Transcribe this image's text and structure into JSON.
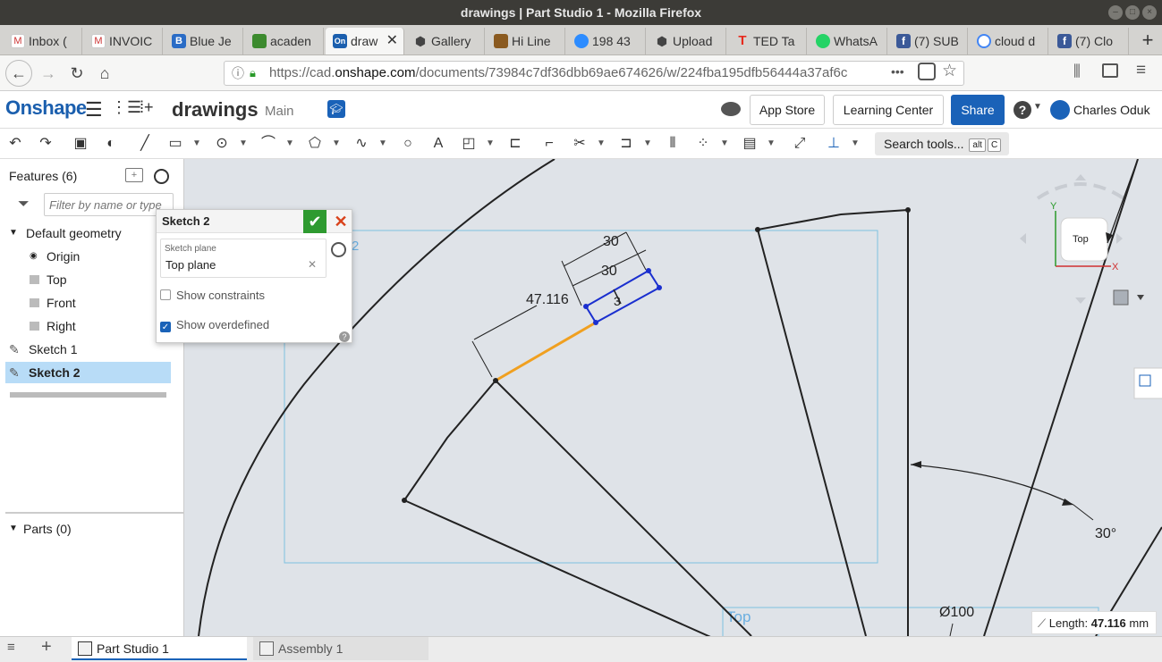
{
  "window": {
    "title": "drawings | Part Studio 1 - Mozilla Firefox"
  },
  "browser_tabs": [
    {
      "label": "Inbox (",
      "icon": "gmail-icon"
    },
    {
      "label": "INVOIC",
      "icon": "gmail-icon"
    },
    {
      "label": "Blue Je",
      "icon": "b-icon"
    },
    {
      "label": "acaden",
      "icon": "puzzle-icon"
    },
    {
      "label": "draw",
      "icon": "onshape-icon",
      "active": true
    },
    {
      "label": "Gallery",
      "icon": "box-icon"
    },
    {
      "label": "Hi Line",
      "icon": "store-icon"
    },
    {
      "label": "198 43",
      "icon": "zoom-icon"
    },
    {
      "label": "Upload",
      "icon": "box-icon"
    },
    {
      "label": "TED Ta",
      "icon": "ted-icon"
    },
    {
      "label": "WhatsA",
      "icon": "whatsapp-icon"
    },
    {
      "label": "(7) SUB",
      "icon": "facebook-icon"
    },
    {
      "label": "cloud d",
      "icon": "google-icon"
    },
    {
      "label": "(7) Clo",
      "icon": "facebook-icon"
    }
  ],
  "navbar": {
    "url_prefix": "https://cad.",
    "url_domain": "onshape.com",
    "url_rest": "/documents/73984c7df36dbb69ae674626/w/224fba195dfb56444a37af6c",
    "more": "•••"
  },
  "header": {
    "logo": "Onshape",
    "doc_name": "drawings",
    "branch": "Main",
    "app_store": "App Store",
    "learning_center": "Learning Center",
    "share": "Share",
    "help": "?",
    "user": "Charles Oduk"
  },
  "toolbar": {
    "search_label": "Search tools...",
    "shortcut_1": "alt",
    "shortcut_2": "C"
  },
  "features": {
    "title": "Features (6)",
    "filter_placeholder": "Filter by name or type",
    "default_geometry": "Default geometry",
    "items": [
      "Origin",
      "Top",
      "Front",
      "Right"
    ],
    "sketch1": "Sketch 1",
    "sketch2": "Sketch 2",
    "parts": "Parts (0)"
  },
  "sketch_dialog": {
    "title": "Sketch 2",
    "plane_label": "Sketch plane",
    "plane_value": "Top plane",
    "show_constraints": "Show constraints",
    "show_overdefined": "Show overdefined",
    "show_constraints_checked": false,
    "show_overdefined_checked": true,
    "help": "?"
  },
  "canvas": {
    "dim_30a": "30",
    "dim_30b": "30",
    "dim_length": "47.116",
    "dim_3": "3",
    "angle": "30°",
    "diameter": "Ø100",
    "plane_label": "Top",
    "plane_label_2": "2",
    "view_cube": "Top",
    "axis_x": "X",
    "axis_y": "Y",
    "length_label": "Length:",
    "length_value": "47.116",
    "length_unit": "mm"
  },
  "bottom_tabs": {
    "part_studio": "Part Studio 1",
    "assembly": "Assembly 1"
  },
  "colors": {
    "brand": "#1b5fae",
    "selection": "#f0a020",
    "sketch_blue": "#1a2fcf",
    "accept": "#2e9a30",
    "cancel": "#d9421b"
  }
}
